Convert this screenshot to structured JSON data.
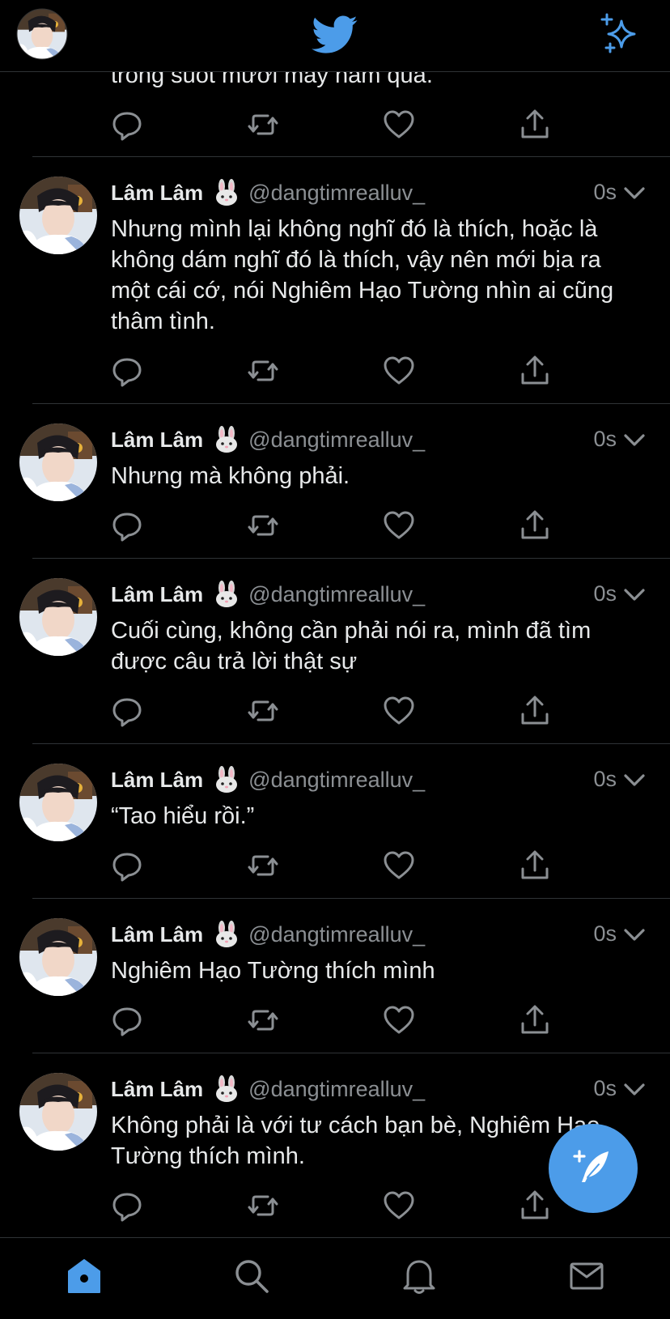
{
  "header": {
    "logo": "twitter-bird-icon",
    "left": "profile-avatar",
    "right": "sparkle-icon"
  },
  "partial_tweet": {
    "text": "trong suốt mười mấy năm qua."
  },
  "tweets": [
    {
      "name": "Lâm Lâm",
      "emoji": "rabbit-emoji",
      "handle": "@dangtimrealluv_",
      "time": "0s",
      "text": "Nhưng mình lại không nghĩ đó là thích, hoặc là không dám nghĩ đó là thích, vậy nên mới bịa ra một cái cớ, nói Nghiêm Hạo Tường nhìn ai cũng thâm tình."
    },
    {
      "name": "Lâm Lâm",
      "emoji": "rabbit-emoji",
      "handle": "@dangtimrealluv_",
      "time": "0s",
      "text": "Nhưng mà không phải."
    },
    {
      "name": "Lâm Lâm",
      "emoji": "rabbit-emoji",
      "handle": "@dangtimrealluv_",
      "time": "0s",
      "text": "Cuối cùng, không cần phải nói ra, mình đã tìm được câu trả lời thật sự"
    },
    {
      "name": "Lâm Lâm",
      "emoji": "rabbit-emoji",
      "handle": "@dangtimrealluv_",
      "time": "0s",
      "text": "“Tao hiểu rồi.”"
    },
    {
      "name": "Lâm Lâm",
      "emoji": "rabbit-emoji",
      "handle": "@dangtimrealluv_",
      "time": "0s",
      "text": "Nghiêm Hạo Tường thích mình"
    },
    {
      "name": "Lâm Lâm",
      "emoji": "rabbit-emoji",
      "handle": "@dangtimrealluv_",
      "time": "0s",
      "text": "Không phải là với tư cách bạn bè, Nghiêm Hạo Tường thích mình."
    }
  ],
  "tabbar": [
    "home-icon",
    "search-icon",
    "bell-icon",
    "mail-icon"
  ],
  "colors": {
    "accent": "#4c9ce9",
    "background": "#000000",
    "muted": "#8b8f93",
    "divider": "#2f3336"
  }
}
